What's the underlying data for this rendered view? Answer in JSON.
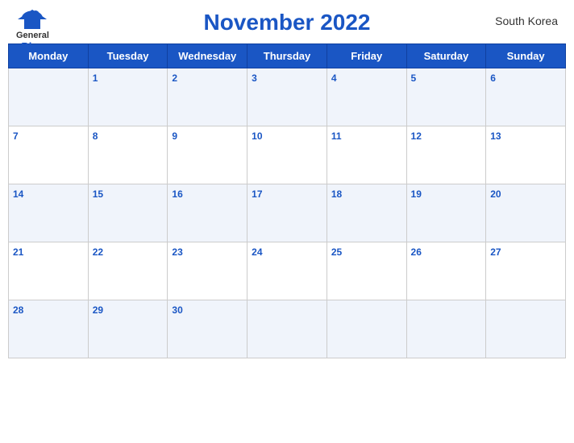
{
  "header": {
    "title": "November 2022",
    "country": "South Korea",
    "logo": {
      "general": "General",
      "blue": "Blue"
    }
  },
  "weekdays": [
    "Monday",
    "Tuesday",
    "Wednesday",
    "Thursday",
    "Friday",
    "Saturday",
    "Sunday"
  ],
  "weeks": [
    [
      null,
      1,
      2,
      3,
      4,
      5,
      6
    ],
    [
      7,
      8,
      9,
      10,
      11,
      12,
      13
    ],
    [
      14,
      15,
      16,
      17,
      18,
      19,
      20
    ],
    [
      21,
      22,
      23,
      24,
      25,
      26,
      27
    ],
    [
      28,
      29,
      30,
      null,
      null,
      null,
      null
    ]
  ]
}
